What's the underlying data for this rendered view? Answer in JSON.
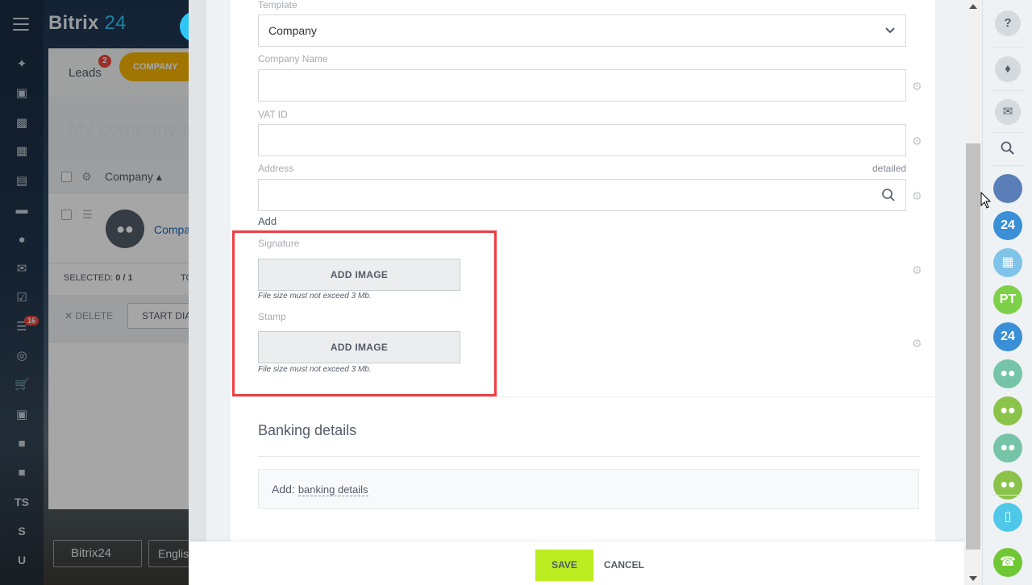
{
  "portal": {
    "logo_text": "Bitrix",
    "logo_num": "24",
    "left_menu_text_items": [
      "TS",
      "S",
      "U"
    ],
    "left_menu_badge": "16",
    "footer_button": "Bitrix24",
    "footer_language": "Englis"
  },
  "crm": {
    "leads_tab": "Leads",
    "leads_badge": "2",
    "company_tab": "COMPANY",
    "page_title": "My company c",
    "grid_column": "Company",
    "row_link": "Compa",
    "selected_label": "SELECTED:",
    "selected_value": "0 / 1",
    "total_label": "TO",
    "delete_label": "DELETE",
    "start_dial_label": "START DIA"
  },
  "form": {
    "template": {
      "label": "Template",
      "value": "Company"
    },
    "company_name": {
      "label": "Company Name",
      "value": ""
    },
    "vat_id": {
      "label": "VAT ID",
      "value": ""
    },
    "address": {
      "label": "Address",
      "value": "",
      "detailed_link": "detailed",
      "add_label": "Add"
    },
    "signature": {
      "label": "Signature",
      "button": "ADD IMAGE",
      "note": "File size must not exceed 3 Mb."
    },
    "stamp": {
      "label": "Stamp",
      "button": "ADD IMAGE",
      "note": "File size must not exceed 3 Mb."
    },
    "banking": {
      "title": "Banking details",
      "add_prefix": "Add:",
      "add_link": "banking details"
    }
  },
  "actions": {
    "save": "SAVE",
    "cancel": "CANCEL"
  },
  "right_panel": {
    "help_icon": "?",
    "avatars": [
      {
        "text": "",
        "color": "#5a7fb8"
      },
      {
        "text": "24",
        "color": "#3a8fd6"
      },
      {
        "text": "",
        "color": "#7fc3e8"
      },
      {
        "text": "PT",
        "color": "#7ed04b"
      },
      {
        "text": "24",
        "color": "#3a8fd6"
      },
      {
        "text": "",
        "color": "#76c4a8"
      },
      {
        "text": "",
        "color": "#8bc34a"
      },
      {
        "text": "",
        "color": "#76c4a8"
      },
      {
        "text": "",
        "color": "#8bc34a"
      }
    ]
  },
  "colors": {
    "accent_blue": "#2fc6f6",
    "save_green": "#bbed21",
    "highlight_red": "#ef3e42",
    "company_tab_orange": "#f7b500"
  }
}
